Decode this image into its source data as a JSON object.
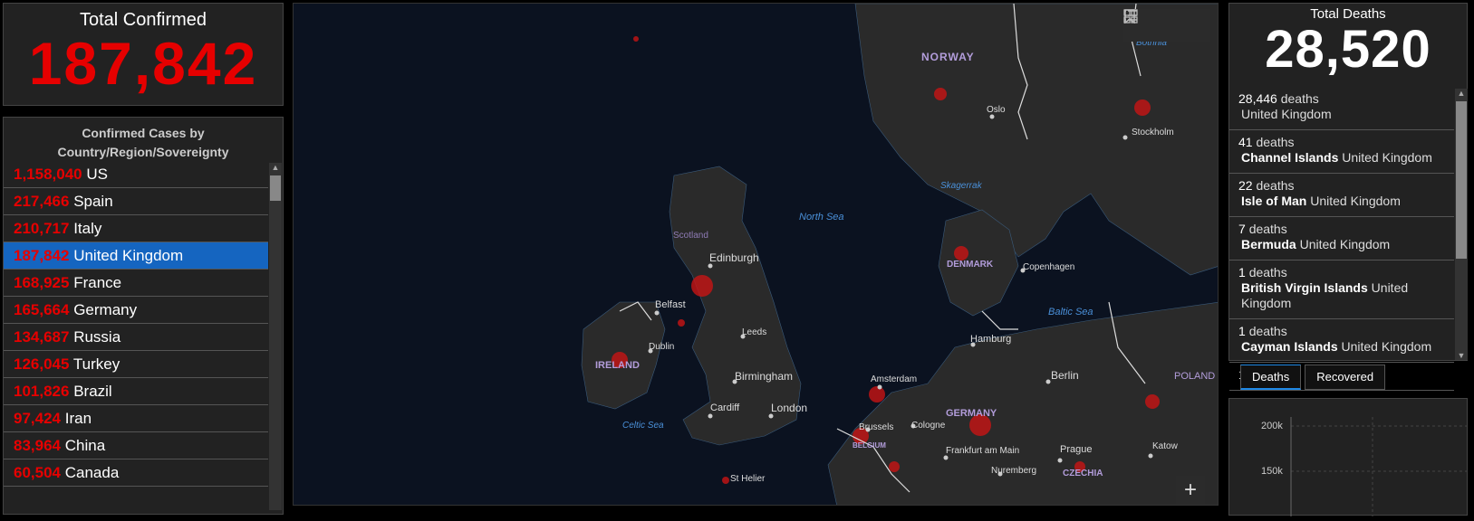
{
  "total_confirmed": {
    "label": "Total Confirmed",
    "value": "187,842"
  },
  "country_list": {
    "header": "Confirmed Cases by Country/Region/Sovereignty",
    "rows": [
      {
        "count": "1,158,040",
        "name": "US"
      },
      {
        "count": "217,466",
        "name": "Spain"
      },
      {
        "count": "210,717",
        "name": "Italy"
      },
      {
        "count": "187,842",
        "name": "United Kingdom",
        "selected": true
      },
      {
        "count": "168,925",
        "name": "France"
      },
      {
        "count": "165,664",
        "name": "Germany"
      },
      {
        "count": "134,687",
        "name": "Russia"
      },
      {
        "count": "126,045",
        "name": "Turkey"
      },
      {
        "count": "101,826",
        "name": "Brazil"
      },
      {
        "count": "97,424",
        "name": "Iran"
      },
      {
        "count": "83,964",
        "name": "China"
      },
      {
        "count": "60,504",
        "name": "Canada"
      }
    ]
  },
  "map": {
    "tools": [
      "bookmark-icon",
      "list-icon",
      "basemap-gallery-icon"
    ],
    "zoom_in": "+",
    "labels": {
      "norway": "NORWAY",
      "oslo": "Oslo",
      "stockholm": "Stockholm",
      "bothnia": "Bothnia",
      "skagerrak": "Skagerrak",
      "north_sea": "North Sea",
      "scotland": "Scotland",
      "edinburgh": "Edinburgh",
      "belfast": "Belfast",
      "denmark": "DENMARK",
      "copenhagen": "Copenhagen",
      "baltic_sea": "Baltic Sea",
      "dublin": "Dublin",
      "leeds": "Leeds",
      "ireland": "IRELAND",
      "hamburg": "Hamburg",
      "amsterdam": "Amsterdam",
      "berlin": "Berlin",
      "poland": "POLAND",
      "birmingham": "Birmingham",
      "london": "London",
      "cardiff": "Cardiff",
      "celtic_sea": "Celtic Sea",
      "brussels": "Brussels",
      "cologne": "Cologne",
      "germany": "GERMANY",
      "belgium": "BELGIUM",
      "frankfurt": "Frankfurt am Main",
      "prague": "Prague",
      "katowice": "Katow",
      "nuremberg": "Nuremberg",
      "czechia": "CZECHIA",
      "st_helier": "St Helier"
    }
  },
  "total_deaths": {
    "label": "Total Deaths",
    "value": "28,520"
  },
  "deaths_list": [
    {
      "count": "28,446",
      "unit": "deaths",
      "place_bold": "",
      "place": "United Kingdom"
    },
    {
      "count": "41",
      "unit": "deaths",
      "place_bold": "Channel Islands",
      "place": "United Kingdom"
    },
    {
      "count": "22",
      "unit": "deaths",
      "place_bold": "Isle of Man",
      "place": "United Kingdom"
    },
    {
      "count": "7",
      "unit": "deaths",
      "place_bold": "Bermuda",
      "place": "United Kingdom"
    },
    {
      "count": "1",
      "unit": "deaths",
      "place_bold": "British Virgin Islands",
      "place": "United Kingdom"
    },
    {
      "count": "1",
      "unit": "deaths",
      "place_bold": "Cayman Islands",
      "place": "United Kingdom"
    },
    {
      "count": "1",
      "unit": "deaths",
      "place_bold": "",
      "place": ""
    }
  ],
  "tabs": {
    "deaths": "Deaths",
    "recovered": "Recovered"
  },
  "chart": {
    "ticks": [
      "200k",
      "150k"
    ]
  }
}
